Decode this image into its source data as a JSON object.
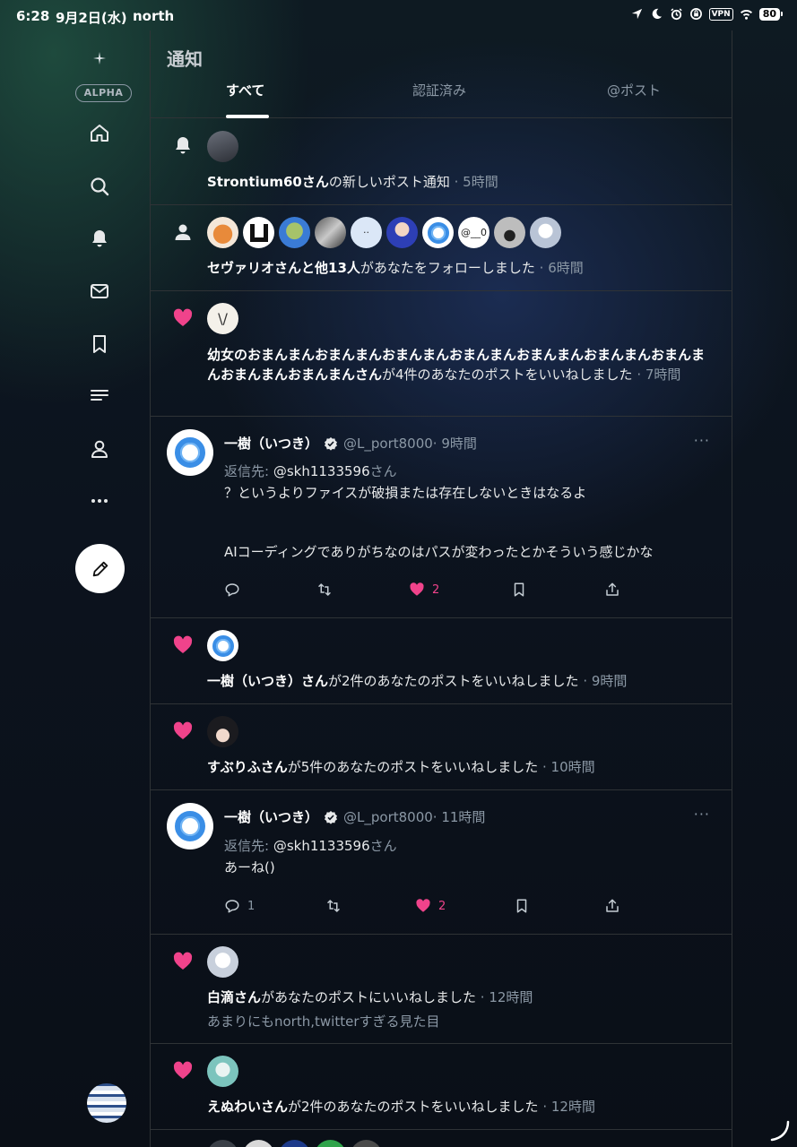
{
  "status_bar": {
    "time": "6:28",
    "date": "9月2日(水)",
    "app": "north",
    "vpn": "VPN",
    "battery": "80"
  },
  "sidebar": {
    "badge": "ALPHA",
    "icons": [
      "sparkle-icon",
      "home-icon",
      "search-icon",
      "bell-icon",
      "mail-icon",
      "bookmark-icon",
      "list-icon",
      "profile-icon",
      "more-icon",
      "pencil-icon"
    ]
  },
  "column": {
    "title": "通知"
  },
  "tabs": [
    {
      "label": "すべて"
    },
    {
      "label": "認証済み"
    },
    {
      "label": "@ポスト"
    }
  ],
  "notifications": [
    {
      "type": "subscribed",
      "name": "Strontium60さん",
      "text": "の新しいポスト通知",
      "time": " · 5時間"
    },
    {
      "type": "follow",
      "name": "セヴァリオさんと他13人",
      "text": "があなたをフォローしました",
      "time": " · 6時間",
      "avatar_text": "@__0"
    },
    {
      "type": "like",
      "name": "幼女のおまんまんおまんまんおまんまんおまんまんおまんまんおまんまんおまんまんおまんまんおまんまんさん",
      "text": "が4件のあなたのポストをいいねしました",
      "time": " · 7時間"
    },
    {
      "type": "like",
      "name": "一樹（いつき）さん",
      "text": "が2件のあなたのポストをいいねしました",
      "time": " · 9時間"
    },
    {
      "type": "like",
      "name": "すぶりふさん",
      "text": "が5件のあなたのポストをいいねしました",
      "time": " · 10時間"
    },
    {
      "type": "like",
      "name": "白滴さん",
      "text": "があなたのポストにいいねしました",
      "time": " · 12時間",
      "sub": "あまりにもnorth,twitterすぎる見た目"
    },
    {
      "type": "like",
      "name": "えぬわいさん",
      "text": "が2件のあなたのポストをいいねしました",
      "time": " · 12時間"
    }
  ],
  "posts": [
    {
      "name": "一樹（いつき）",
      "handle": "@L_port8000",
      "time": " · 9時間",
      "more": "···",
      "reply_prefix": "返信先: ",
      "reply_to": "@skh1133596",
      "reply_suffix": "さん",
      "body_line1": "？というよりファイスが破損または存在しないときはなるよ",
      "body_line2": "AIコーディングでありがちなのはパスが変わったとかそういう感じかな",
      "replies": "",
      "likes": "2"
    },
    {
      "name": "一樹（いつき）",
      "handle": "@L_port8000",
      "time": " · 11時間",
      "more": "···",
      "reply_prefix": "返信先: ",
      "reply_to": "@skh1133596",
      "reply_suffix": "さん",
      "body_line1": "あーね()",
      "replies": "1",
      "likes": "2"
    }
  ],
  "colors": {
    "like": "#f0438b",
    "verified": "#e7e9ea",
    "accent_ring": "#3a8ee6"
  }
}
